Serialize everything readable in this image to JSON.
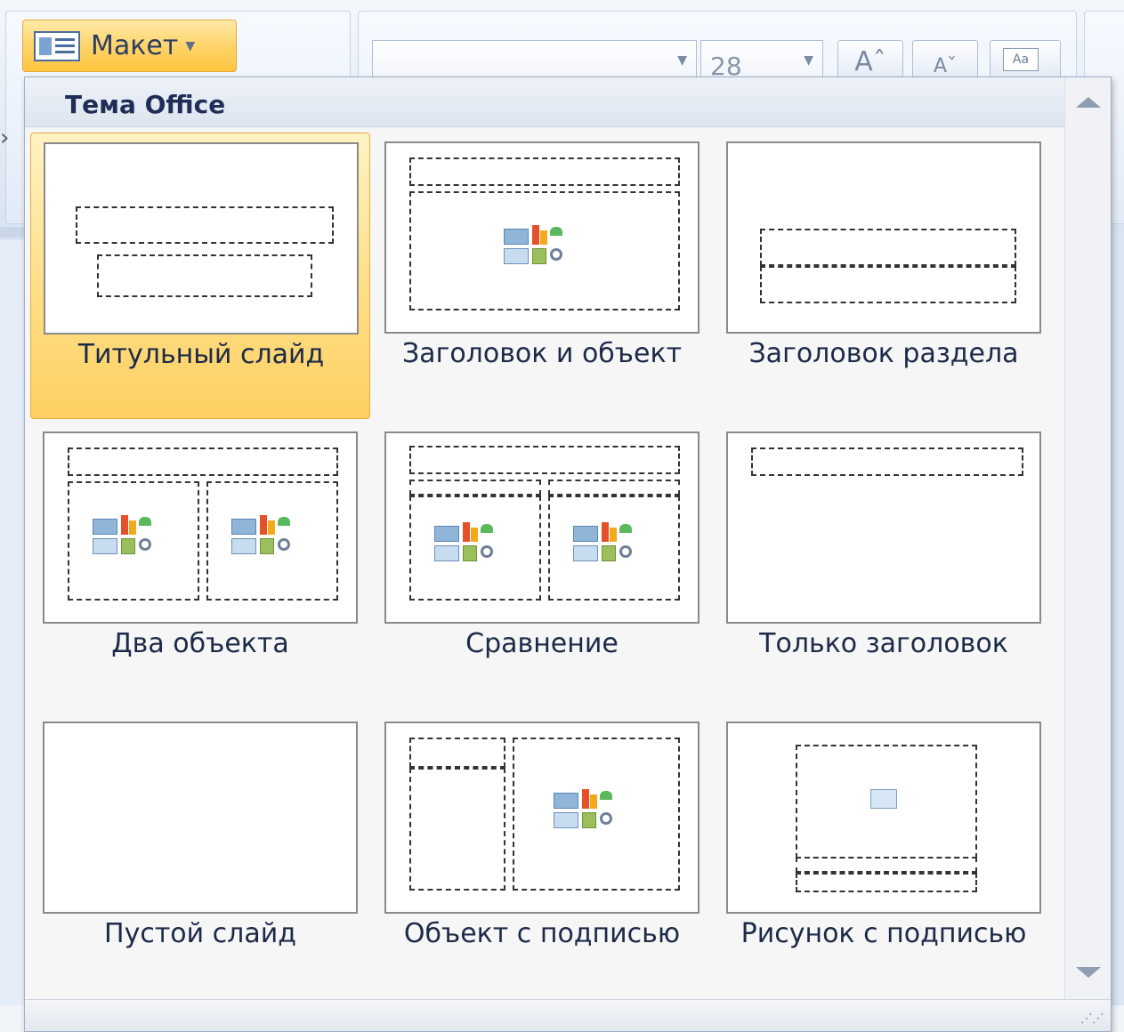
{
  "ribbon": {
    "layout_button_label": "Макет",
    "font_size_value": "28",
    "grow_font_glyph": "Aˆ",
    "shrink_font_glyph": "Aˇ",
    "clear_format_glyph": "Aa"
  },
  "gallery": {
    "header": "Тема Office",
    "layouts": [
      {
        "label": "Титульный слайд",
        "selected": true
      },
      {
        "label": "Заголовок и объект",
        "selected": false
      },
      {
        "label": "Заголовок раздела",
        "selected": false
      },
      {
        "label": "Два объекта",
        "selected": false
      },
      {
        "label": "Сравнение",
        "selected": false
      },
      {
        "label": "Только заголовок",
        "selected": false
      },
      {
        "label": "Пустой слайд",
        "selected": false
      },
      {
        "label": "Объект с подписью",
        "selected": false
      },
      {
        "label": "Рисунок с подписью",
        "selected": false
      }
    ]
  },
  "colors": {
    "selected_tile": "#ffdf86",
    "ribbon_bg": "#e3ebf6"
  },
  "icons": [
    "layout-icon",
    "chevron-down-icon",
    "content-placeholder-icon",
    "picture-icon",
    "scroll-up-icon",
    "scroll-down-icon",
    "resize-grip-icon"
  ]
}
